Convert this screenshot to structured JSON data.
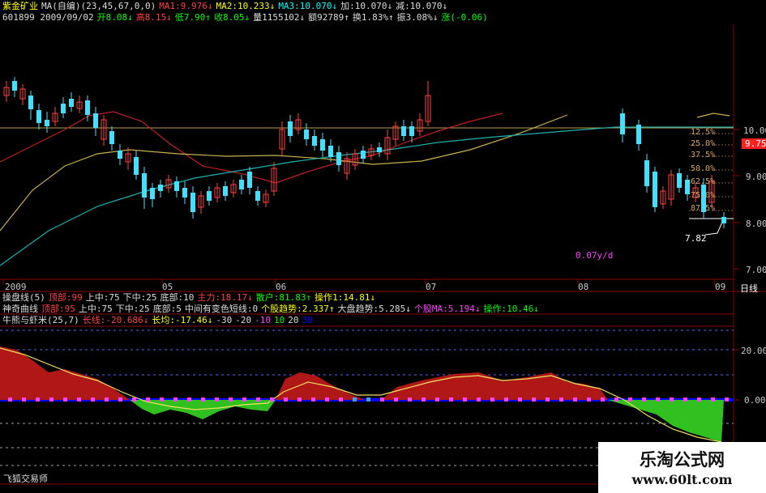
{
  "header": {
    "line1": [
      {
        "t": "紫金矿业",
        "c": "#ffff00"
      },
      {
        "t": "MA(自编)(23,45,67,0,0)",
        "c": "#dddddd"
      },
      {
        "t": "MA1:9.976↓",
        "c": "#ff4040"
      },
      {
        "t": "MA2:10.233↓",
        "c": "#ffff00"
      },
      {
        "t": "MA3:10.070↓",
        "c": "#00ffff"
      },
      {
        "t": "加:10.070↓",
        "c": "#dddddd"
      },
      {
        "t": "减:10.070↓",
        "c": "#dddddd"
      }
    ],
    "line2": [
      {
        "t": "601899 2009/09/02",
        "c": "#dddddd"
      },
      {
        "t": "开8.08↓",
        "c": "#00ff00"
      },
      {
        "t": "高8.15↓",
        "c": "#ff4040"
      },
      {
        "t": "低7.90↑",
        "c": "#00ff00"
      },
      {
        "t": "收8.05↓",
        "c": "#00ff00"
      },
      {
        "t": "量1155102↓",
        "c": "#dddddd"
      },
      {
        "t": "额92789↑",
        "c": "#dddddd"
      },
      {
        "t": "换1.83%↑",
        "c": "#dddddd"
      },
      {
        "t": "振3.08%↓",
        "c": "#dddddd"
      },
      {
        "t": "涨(-0.06)",
        "c": "#00ff00"
      }
    ]
  },
  "price_axis": {
    "labels": [
      "10.00",
      "9.00",
      "8.00",
      "7.00"
    ],
    "current": "9.75",
    "current_bg": "#ff2020"
  },
  "date_axis": {
    "labels": [
      "2009",
      "05",
      "06",
      "07",
      "08",
      "09"
    ],
    "period": "日线"
  },
  "annotations": {
    "fib": [
      "12.5%",
      "25.0%",
      "37.5%",
      "50.0%",
      "62.5%",
      "75.0%",
      "87.5%"
    ],
    "low_price": "7.82",
    "speed": "0.07y/d"
  },
  "indicators": {
    "line1": [
      {
        "t": "操盘线(5)",
        "c": "#dddddd"
      },
      {
        "t": "顶部:99",
        "c": "#ff4040"
      },
      {
        "t": "上中:75",
        "c": "#dddddd"
      },
      {
        "t": "下中:25",
        "c": "#dddddd"
      },
      {
        "t": "底部:10",
        "c": "#dddddd"
      },
      {
        "t": "主力:18.17↓",
        "c": "#ff4040"
      },
      {
        "t": "散户:81.83↑",
        "c": "#00ff00"
      },
      {
        "t": "操作1:14.81↓",
        "c": "#ffff00"
      }
    ],
    "line2": [
      {
        "t": "神奇曲线",
        "c": "#dddddd"
      },
      {
        "t": "顶部:95",
        "c": "#ff4040"
      },
      {
        "t": "上中:75",
        "c": "#dddddd"
      },
      {
        "t": "下中:25",
        "c": "#dddddd"
      },
      {
        "t": "底部:5",
        "c": "#dddddd"
      },
      {
        "t": "中间有变色短线:0",
        "c": "#dddddd"
      },
      {
        "t": "个股趋势:2.337↑",
        "c": "#ffff00"
      },
      {
        "t": "大盘趋势:5.285↓",
        "c": "#dddddd"
      },
      {
        "t": "个股MA:5.194↓",
        "c": "#ff40ff"
      },
      {
        "t": "操作:10.46↓",
        "c": "#00ff00"
      }
    ],
    "line3": [
      {
        "t": "牛熊与虾米(25,7)",
        "c": "#dddddd"
      },
      {
        "t": "长线:-20.686↓",
        "c": "#ff4040"
      },
      {
        "t": "长均:-17.46↓",
        "c": "#ffff00"
      },
      {
        "t": "-30",
        "c": "#dddddd"
      },
      {
        "t": "-20",
        "c": "#dddddd"
      },
      {
        "t": "-10",
        "c": "#ff40ff"
      },
      {
        "t": "10",
        "c": "#00ff00"
      },
      {
        "t": "20",
        "c": "#dddddd"
      },
      {
        "t": "30",
        "c": "#0000ff"
      }
    ]
  },
  "osc_axis": {
    "labels": [
      "20.00",
      "0.00"
    ]
  },
  "footer": {
    "author": "飞狐交易师"
  },
  "watermark": {
    "title": "乐淘公式网",
    "url": "www.60lt.com"
  }
}
